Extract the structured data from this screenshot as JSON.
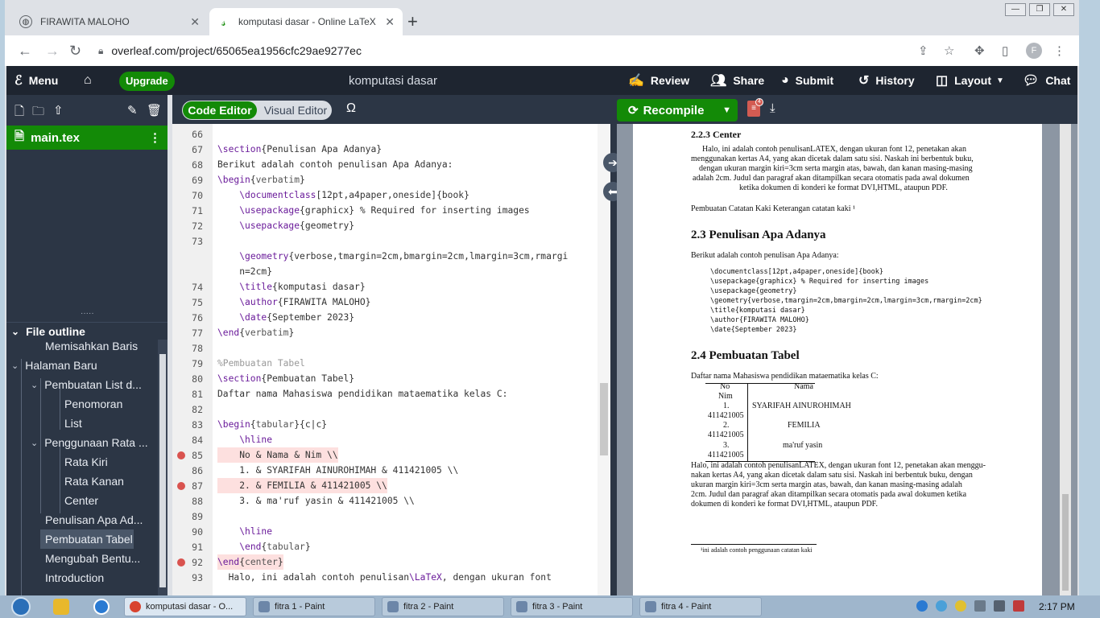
{
  "browser": {
    "tabs": [
      {
        "title": "FIRAWITA MALOHO",
        "close": "✕"
      },
      {
        "title": "komputasi dasar - Online LaTeX",
        "close": "✕"
      }
    ],
    "new_tab": "+",
    "url": "overleaf.com/project/65065ea1956cfc29ae9277ec",
    "avatar_letter": "F",
    "window_controls": [
      "—",
      "❐",
      "✕"
    ]
  },
  "overleaf": {
    "menu_label": "Menu",
    "upgrade_label": "Upgrade",
    "project_title": "komputasi dasar",
    "actions": [
      {
        "label": "Review",
        "icon": "review-icon"
      },
      {
        "label": "Share",
        "icon": "share-icon"
      },
      {
        "label": "Submit",
        "icon": "submit-icon"
      },
      {
        "label": "History",
        "icon": "history-icon"
      },
      {
        "label": "Layout",
        "icon": "layout-icon"
      },
      {
        "label": "Chat",
        "icon": "chat-icon"
      }
    ],
    "accent": "#138a07"
  },
  "file_tree": {
    "files": [
      {
        "name": "main.tex"
      }
    ],
    "outline_title": "File outline",
    "outline": [
      {
        "label": "Memisahkan Baris"
      },
      {
        "label": "Halaman Baru"
      },
      {
        "label": "Pembuatan List d..."
      },
      {
        "label": "Penomoran"
      },
      {
        "label": "List"
      },
      {
        "label": "Penggunaan Rata ..."
      },
      {
        "label": "Rata Kiri"
      },
      {
        "label": "Rata Kanan"
      },
      {
        "label": "Center"
      },
      {
        "label": "Penulisan Apa Ad..."
      },
      {
        "label": "Pembuatan Tabel"
      },
      {
        "label": "Mengubah Bentu..."
      },
      {
        "label": "Introduction"
      }
    ]
  },
  "editor": {
    "code_editor_label": "Code Editor",
    "visual_editor_label": "Visual Editor",
    "omega": "Ω",
    "lines": [
      {
        "n": "66",
        "text": ""
      },
      {
        "n": "67",
        "text": "\\section{Penulisan Apa Adanya}"
      },
      {
        "n": "68",
        "text": "Berikut adalah contoh penulisan Apa Adanya:"
      },
      {
        "n": "69",
        "text": "\\begin{verbatim}"
      },
      {
        "n": "70",
        "text": "    \\documentclass[12pt,a4paper,oneside]{book}"
      },
      {
        "n": "71",
        "text": "    \\usepackage{graphicx} % Required for inserting images"
      },
      {
        "n": "72",
        "text": "    \\usepackage{geometry}"
      },
      {
        "n": "73",
        "text": ""
      },
      {
        "n": "",
        "text": "    \\geometry{verbose,tmargin=2cm,bmargin=2cm,lmargin=3cm,rmargi"
      },
      {
        "n": "",
        "text": "    n=2cm}"
      },
      {
        "n": "74",
        "text": "    \\title{komputasi dasar}"
      },
      {
        "n": "75",
        "text": "    \\author{FIRAWITA MALOHO}"
      },
      {
        "n": "76",
        "text": "    \\date{September 2023}"
      },
      {
        "n": "77",
        "text": "\\end{verbatim}"
      },
      {
        "n": "78",
        "text": ""
      },
      {
        "n": "79",
        "text": "%Pembuatan Tabel"
      },
      {
        "n": "80",
        "text": "\\section{Pembuatan Tabel}"
      },
      {
        "n": "81",
        "text": "Daftar nama Mahasiswa pendidikan mataematika kelas C:"
      },
      {
        "n": "82",
        "text": ""
      },
      {
        "n": "83",
        "text": "\\begin{tabular}{c|c}"
      },
      {
        "n": "84",
        "text": "    \\hline"
      },
      {
        "n": "85",
        "text": "    No & Nama & Nim \\\\"
      },
      {
        "n": "86",
        "text": "    1. & SYARIFAH AINUROHIMAH & 411421005 \\\\"
      },
      {
        "n": "87",
        "text": "    2. & FEMILIA & 411421005 \\\\"
      },
      {
        "n": "88",
        "text": "    3. & ma'ruf yasin & 411421005 \\\\"
      },
      {
        "n": "89",
        "text": ""
      },
      {
        "n": "90",
        "text": "    \\hline"
      },
      {
        "n": "91",
        "text": "    \\end{tabular}"
      },
      {
        "n": "92",
        "text": "\\end{center}"
      },
      {
        "n": "93",
        "text": "  Halo, ini adalah contoh penulisan\\LaTeX, dengan ukuran font"
      }
    ],
    "error_lines": [
      "85",
      "87",
      "92"
    ]
  },
  "pdf": {
    "recompile_label": "Recompile",
    "log_count": "4",
    "h_center": "2.2.3   Center",
    "p_center": [
      "Halo, ini adalah contoh penulisanLATEX, dengan ukuran font 12, penetakan akan",
      "menggunakan kertas A4, yang akan dicetak dalam satu sisi. Naskah ini berbentuk buku,",
      "dengan ukuran margin kiri=3cm serta margin atas, bawah, dan kanan masing-masing",
      "adalah 2cm.  Judul dan paragraf akan ditampilkan secara otomatis pada awal dokumen",
      "ketika dokumen di konderi ke format DVI,HTML, ataupun PDF."
    ],
    "p_footnote_ref": "Pembuatan Catatan Kaki Keterangan catatan kaki ¹",
    "h_penulisan": "2.3    Penulisan Apa Adanya",
    "p_berikut": "Berikut adalah contoh penulisan Apa Adanya:",
    "verbatim": [
      "\\documentclass[12pt,a4paper,oneside]{book}",
      "\\usepackage{graphicx} % Required for inserting images",
      "\\usepackage{geometry}",
      "\\geometry{verbose,tmargin=2cm,bmargin=2cm,lmargin=3cm,rmargin=2cm}",
      "\\title{komputasi dasar}",
      "\\author{FIRAWITA MALOHO}",
      "\\date{September 2023}"
    ],
    "h_tabel": "2.4    Pembuatan Tabel",
    "p_daftar": "Daftar nama Mahasiswa pendidikan mataematika kelas C:",
    "table": [
      [
        "No",
        "Nama"
      ],
      [
        "Nim",
        ""
      ],
      [
        "1.",
        "SYARIFAH AINUROHIMAH"
      ],
      [
        "411421005",
        ""
      ],
      [
        "2.",
        "FEMILIA"
      ],
      [
        "411421005",
        ""
      ],
      [
        "3.",
        "ma'ruf yasin"
      ],
      [
        "411421005",
        ""
      ]
    ],
    "p_halo": [
      "Halo, ini adalah contoh penulisanLATEX, dengan ukuran font 12, penetakan akan menggu-",
      "nakan kertas A4, yang akan dicetak dalam satu sisi. Naskah ini berbentuk buku, dengan",
      "ukuran margin kiri=3cm serta margin atas, bawah, dan kanan masing-masing adalah",
      "2cm.  Judul dan paragraf akan ditampilkan secara otomatis pada awal dokumen ketika",
      "dokumen di konderi ke format DVI,HTML, ataupun PDF."
    ],
    "footnote": "¹ini adalah contoh penggunaan catatan kaki"
  },
  "taskbar": {
    "items": [
      {
        "label": "komputasi dasar - O..."
      },
      {
        "label": "fitra 1 - Paint"
      },
      {
        "label": "fitra 2 - Paint"
      },
      {
        "label": "fitra 3 - Paint"
      },
      {
        "label": "fitra 4 - Paint"
      }
    ],
    "time": "2:17 PM"
  }
}
